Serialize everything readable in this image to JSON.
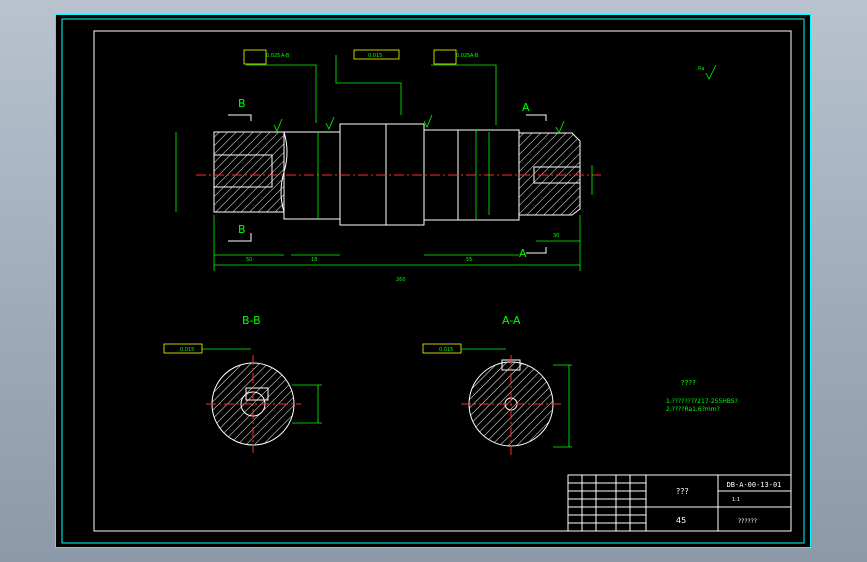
{
  "views": {
    "section_bb": "B-B",
    "section_aa": "A-A",
    "cut_b_top": "B",
    "cut_b_bottom": "B",
    "cut_a_top": "A",
    "cut_a_bottom": "A"
  },
  "dimensions": {
    "overall_length": "260",
    "left_len": "50",
    "right_len": "30",
    "segment_a": "18",
    "segment_b": "55"
  },
  "tolerance_frames": {
    "left_sym": "0.025",
    "left_ref": "A-B",
    "center": "0.015",
    "right_sym": "0.025",
    "right_ref": "A-B",
    "bb_frame": "0.015",
    "aa_frame": "0.015"
  },
  "notes": {
    "heading": "????",
    "line1": "1.????????217-255HBS?",
    "line2": "2.????Ra1.6?mm?"
  },
  "title_block": {
    "drawing_no": "DB-A-00-13-01",
    "part_name": "???",
    "material": "45",
    "company": "??????",
    "scale": "1:1"
  },
  "roughness": {
    "corner": "Ra"
  }
}
